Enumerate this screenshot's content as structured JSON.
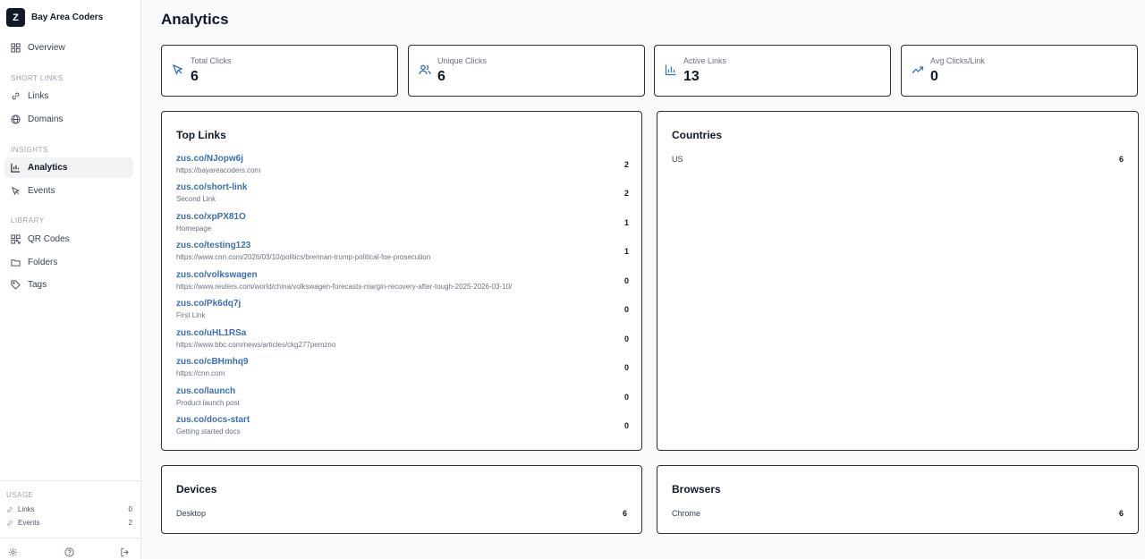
{
  "brand": {
    "logo_letter": "Z",
    "name": "Bay Area Coders"
  },
  "sidebar": {
    "overview": "Overview",
    "sections": {
      "short_links": "SHORT LINKS",
      "insights": "INSIGHTS",
      "library": "LIBRARY"
    },
    "items": {
      "links": "Links",
      "domains": "Domains",
      "analytics": "Analytics",
      "events": "Events",
      "qr_codes": "QR Codes",
      "folders": "Folders",
      "tags": "Tags"
    },
    "usage": {
      "label": "USAGE",
      "rows": [
        {
          "label": "Links",
          "value": "0"
        },
        {
          "label": "Events",
          "value": "2"
        }
      ]
    }
  },
  "main": {
    "title": "Analytics",
    "stats": [
      {
        "label": "Total Clicks",
        "value": "6",
        "icon": "cursor-icon"
      },
      {
        "label": "Unique Clicks",
        "value": "6",
        "icon": "users-icon"
      },
      {
        "label": "Active Links",
        "value": "13",
        "icon": "bar-chart-icon"
      },
      {
        "label": "Avg Clicks/Link",
        "value": "0",
        "icon": "trending-up-icon"
      }
    ],
    "top_links": {
      "title": "Top Links",
      "rows": [
        {
          "short": "zus.co/NJopw6j",
          "sub": "https://bayareacoders.com",
          "count": "2"
        },
        {
          "short": "zus.co/short-link",
          "sub": "Second Link",
          "count": "2"
        },
        {
          "short": "zus.co/xpPX81O",
          "sub": "Homepage",
          "count": "1"
        },
        {
          "short": "zus.co/testing123",
          "sub": "https://www.cnn.com/2026/03/10/politics/brennan-trump-political-foe-prosecution",
          "count": "1"
        },
        {
          "short": "zus.co/volkswagen",
          "sub": "https://www.reuters.com/world/china/volkswagen-forecasts-margin-recovery-after-tough-2025-2026-03-10/",
          "count": "0"
        },
        {
          "short": "zus.co/Pk6dq7j",
          "sub": "First Link",
          "count": "0"
        },
        {
          "short": "zus.co/uHL1RSa",
          "sub": "https://www.bbc.com/news/articles/ckg277pemzno",
          "count": "0"
        },
        {
          "short": "zus.co/cBHmhq9",
          "sub": "https://cnn.com",
          "count": "0"
        },
        {
          "short": "zus.co/launch",
          "sub": "Product launch post",
          "count": "0"
        },
        {
          "short": "zus.co/docs-start",
          "sub": "Getting started docs",
          "count": "0"
        }
      ]
    },
    "countries": {
      "title": "Countries",
      "rows": [
        {
          "label": "US",
          "value": "6"
        }
      ]
    },
    "devices": {
      "title": "Devices",
      "rows": [
        {
          "label": "Desktop",
          "value": "6"
        }
      ]
    },
    "browsers": {
      "title": "Browsers",
      "rows": [
        {
          "label": "Chrome",
          "value": "6"
        }
      ]
    }
  },
  "colors": {
    "accent": "#3b6fb6",
    "card_border": "#2b2f36",
    "active_nav": "#f1f2f4"
  }
}
